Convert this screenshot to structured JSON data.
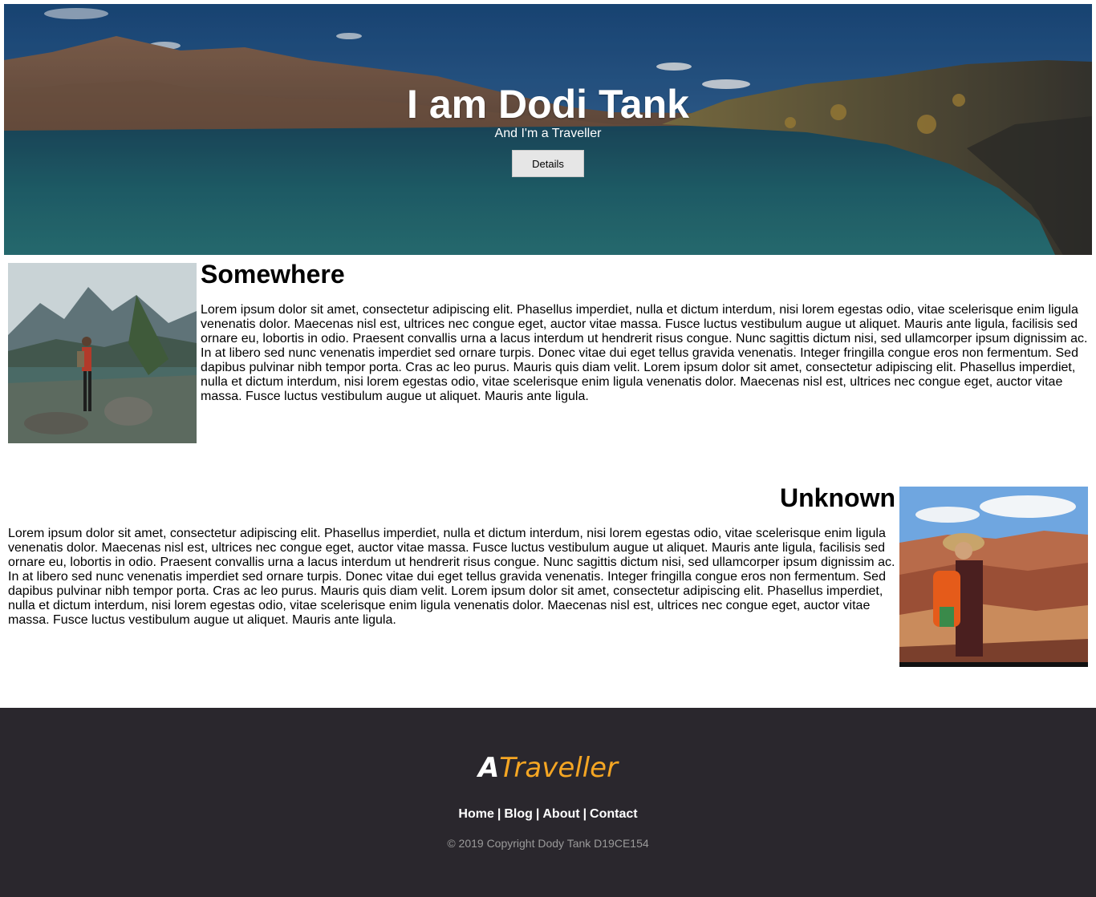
{
  "hero": {
    "title": "I am Dodi Tank",
    "subtitle": "And I'm a Traveller",
    "button_label": "Details"
  },
  "sections": [
    {
      "title": "Somewhere",
      "text": "Lorem ipsum dolor sit amet, consectetur adipiscing elit. Phasellus imperdiet, nulla et dictum interdum, nisi lorem egestas odio, vitae scelerisque enim ligula venenatis dolor. Maecenas nisl est, ultrices nec congue eget, auctor vitae massa. Fusce luctus vestibulum augue ut aliquet. Mauris ante ligula, facilisis sed ornare eu, lobortis in odio. Praesent convallis urna a lacus interdum ut hendrerit risus congue. Nunc sagittis dictum nisi, sed ullamcorper ipsum dignissim ac. In at libero sed nunc venenatis imperdiet sed ornare turpis. Donec vitae dui eget tellus gravida venenatis. Integer fringilla congue eros non fermentum. Sed dapibus pulvinar nibh tempor porta. Cras ac leo purus. Mauris quis diam velit. Lorem ipsum dolor sit amet, consectetur adipiscing elit. Phasellus imperdiet, nulla et dictum interdum, nisi lorem egestas odio, vitae scelerisque enim ligula venenatis dolor. Maecenas nisl est, ultrices nec congue eget, auctor vitae massa. Fusce luctus vestibulum augue ut aliquet. Mauris ante ligula."
    },
    {
      "title": "Unknown",
      "text": "Lorem ipsum dolor sit amet, consectetur adipiscing elit. Phasellus imperdiet, nulla et dictum interdum, nisi lorem egestas odio, vitae scelerisque enim ligula venenatis dolor. Maecenas nisl est, ultrices nec congue eget, auctor vitae massa. Fusce luctus vestibulum augue ut aliquet. Mauris ante ligula, facilisis sed ornare eu, lobortis in odio. Praesent convallis urna a lacus interdum ut hendrerit risus congue. Nunc sagittis dictum nisi, sed ullamcorper ipsum dignissim ac. In at libero sed nunc venenatis imperdiet sed ornare turpis. Donec vitae dui eget tellus gravida venenatis. Integer fringilla congue eros non fermentum. Sed dapibus pulvinar nibh tempor porta. Cras ac leo purus. Mauris quis diam velit. Lorem ipsum dolor sit amet, consectetur adipiscing elit. Phasellus imperdiet, nulla et dictum interdum, nisi lorem egestas odio, vitae scelerisque enim ligula venenatis dolor. Maecenas nisl est, ultrices nec congue eget, auctor vitae massa. Fusce luctus vestibulum augue ut aliquet. Mauris ante ligula."
    }
  ],
  "footer": {
    "logo_part1": "A",
    "logo_part2": "Traveller",
    "nav": [
      "Home",
      "Blog",
      "About",
      "Contact"
    ],
    "separator": "|",
    "copyright": "© 2019 Copyright Dody Tank D19CE154"
  },
  "colors": {
    "footer_bg": "#2a272d",
    "logo_accent": "#f5a623",
    "copyright_text": "#9a9a9a"
  }
}
